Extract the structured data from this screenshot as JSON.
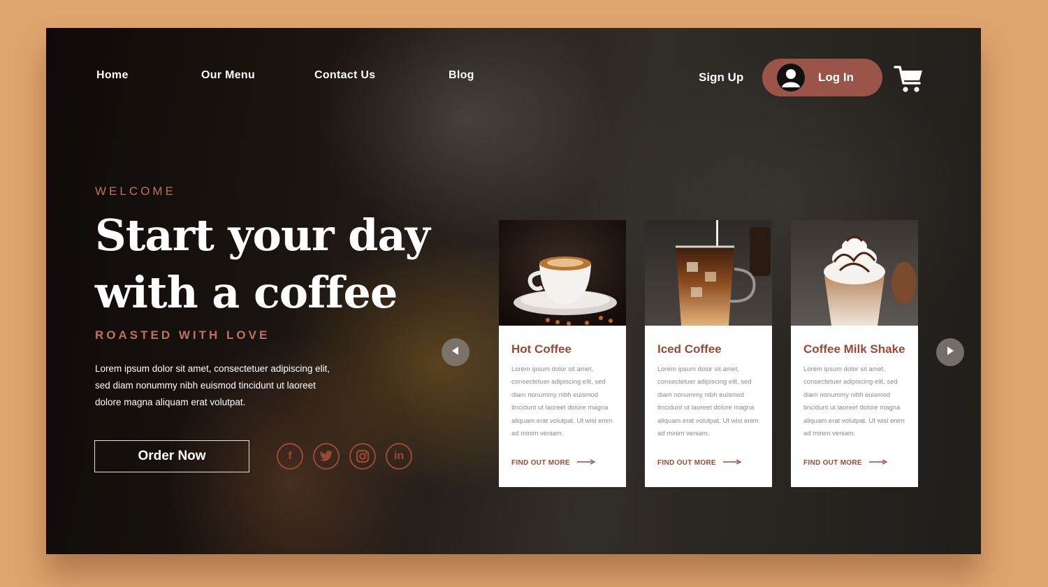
{
  "nav": {
    "items": [
      {
        "label": "Home"
      },
      {
        "label": "Our Menu"
      },
      {
        "label": "Contact Us"
      },
      {
        "label": "Blog"
      }
    ],
    "signup_label": "Sign Up",
    "login_label": "Log In",
    "cart_icon": "shopping-cart-icon"
  },
  "hero": {
    "eyebrow": "WELCOME",
    "headline_line1": "Start your day",
    "headline_line2": "with a coffee",
    "subheading": "ROASTED WITH LOVE",
    "lead": "Lorem ipsum dolor sit amet, consectetuer adipiscing elit, sed diam nonummy nibh euismod tincidunt ut laoreet dolore magna aliquam erat volutpat.",
    "cta_label": "Order Now"
  },
  "social": [
    {
      "icon": "facebook-icon",
      "glyph": "f"
    },
    {
      "icon": "twitter-icon",
      "glyph": "t"
    },
    {
      "icon": "instagram-icon",
      "glyph": "◎"
    },
    {
      "icon": "linkedin-icon",
      "glyph": "in"
    }
  ],
  "carousel": {
    "cards": [
      {
        "title": "Hot Coffee",
        "description": "Lorem ipsum dolor sit amet, consectetuer adipiscing elit, sed diam nonummy nibh euismod tincidunt ut laoreet dolore magna aliquam erat volutpat. Ut wisi enim ad minim veniam.",
        "link_label": "FIND OUT MORE"
      },
      {
        "title": "Iced Coffee",
        "description": "Lorem ipsum dolor sit amet, consectetuer adipiscing elit, sed diam nonummy nibh euismod tincidunt ut laoreet dolore magna aliquam erat volutpat. Ut wisi enim ad minim veniam.",
        "link_label": "FIND OUT MORE"
      },
      {
        "title": "Coffee Milk Shake",
        "description": "Lorem ipsum dolor sit amet, consectetuer adipiscing elit, sed diam nonummy nibh euismod tincidunt ut laoreet dolore magna aliquam erat volutpat. Ut wisi enim ad minim veniam.",
        "link_label": "FIND OUT MORE"
      }
    ]
  },
  "colors": {
    "accent": "#9a5548",
    "accent_text": "#c0715d",
    "card_title": "#9a4a34",
    "page_background": "#e0a46f"
  }
}
